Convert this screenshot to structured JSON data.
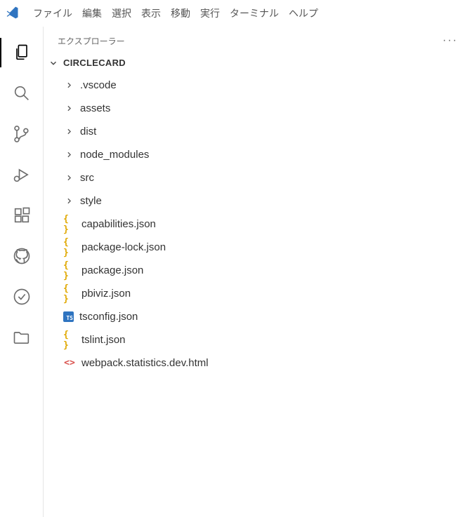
{
  "menubar": {
    "file": "ファイル",
    "edit": "編集",
    "selection": "選択",
    "view": "表示",
    "go": "移動",
    "run": "実行",
    "terminal": "ターミナル",
    "help": "ヘルプ"
  },
  "sidebar": {
    "header": "エクスプローラー",
    "root": "CIRCLECARD",
    "folders": [
      {
        "name": ".vscode"
      },
      {
        "name": "assets"
      },
      {
        "name": "dist"
      },
      {
        "name": "node_modules"
      },
      {
        "name": "src"
      },
      {
        "name": "style"
      }
    ],
    "files": [
      {
        "name": "capabilities.json",
        "icon": "json"
      },
      {
        "name": "package-lock.json",
        "icon": "json"
      },
      {
        "name": "package.json",
        "icon": "json"
      },
      {
        "name": "pbiviz.json",
        "icon": "json"
      },
      {
        "name": "tsconfig.json",
        "icon": "ts"
      },
      {
        "name": "tslint.json",
        "icon": "json"
      },
      {
        "name": "webpack.statistics.dev.html",
        "icon": "html"
      }
    ]
  }
}
